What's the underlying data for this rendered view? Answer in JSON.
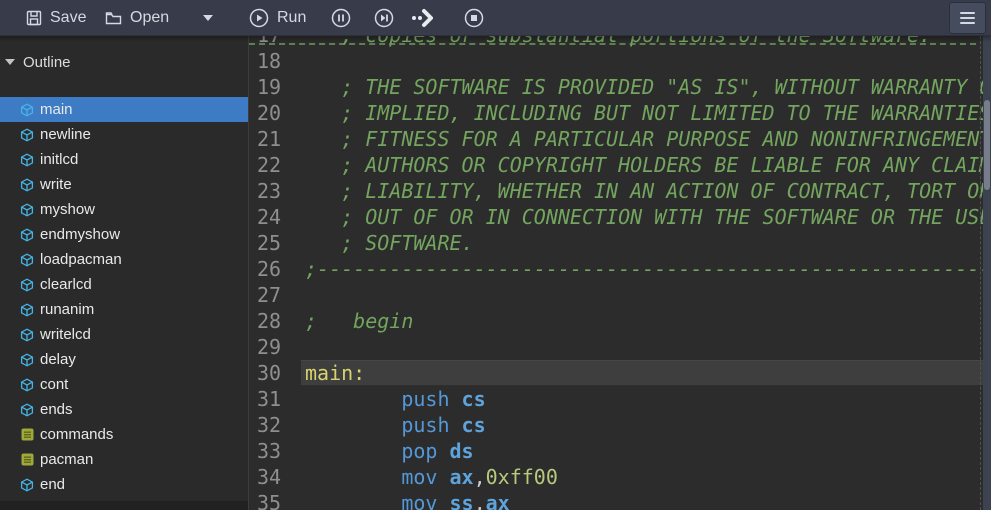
{
  "toolbar": {
    "save_label": "Save",
    "open_label": "Open",
    "run_label": "Run",
    "icons": [
      "floppy-icon",
      "folder-open-icon",
      "dropdown-caret-icon",
      "run-circle-icon",
      "pause-circle-icon",
      "step-forward-circle-icon",
      "fast-forward-icon",
      "stop-circle-icon",
      "hamburger-menu-icon"
    ],
    "colors": {
      "background": "#383c4a",
      "text": "#d3dae3"
    }
  },
  "sidebar": {
    "header": "Outline",
    "items": [
      {
        "label": "main",
        "icon": "cube-symbol-icon",
        "selected": true
      },
      {
        "label": "newline",
        "icon": "cube-symbol-icon",
        "selected": false
      },
      {
        "label": "initlcd",
        "icon": "cube-symbol-icon",
        "selected": false
      },
      {
        "label": "write",
        "icon": "cube-symbol-icon",
        "selected": false
      },
      {
        "label": "myshow",
        "icon": "cube-symbol-icon",
        "selected": false
      },
      {
        "label": "endmyshow",
        "icon": "cube-symbol-icon",
        "selected": false
      },
      {
        "label": "loadpacman",
        "icon": "cube-symbol-icon",
        "selected": false
      },
      {
        "label": "clearlcd",
        "icon": "cube-symbol-icon",
        "selected": false
      },
      {
        "label": "runanim",
        "icon": "cube-symbol-icon",
        "selected": false
      },
      {
        "label": "writelcd",
        "icon": "cube-symbol-icon",
        "selected": false
      },
      {
        "label": "delay",
        "icon": "cube-symbol-icon",
        "selected": false
      },
      {
        "label": "cont",
        "icon": "cube-symbol-icon",
        "selected": false
      },
      {
        "label": "ends",
        "icon": "cube-symbol-icon",
        "selected": false
      },
      {
        "label": "commands",
        "icon": "data-list-icon",
        "selected": false
      },
      {
        "label": "pacman",
        "icon": "data-list-icon",
        "selected": false
      },
      {
        "label": "end",
        "icon": "cube-symbol-icon",
        "selected": false
      }
    ],
    "colors": {
      "selection": "#3d7cc4",
      "cube": "#45b4e6",
      "data": "#9fa838"
    }
  },
  "editor": {
    "colors": {
      "background": "#2c2c2c",
      "comment": "#73a55f",
      "keyword": "#5498d7",
      "register": "#5fa3dc",
      "number": "#b6ca7e",
      "label": "#d9d26e",
      "line_number": "#8f8f8f",
      "current_line": "#3e3e3e"
    },
    "lines": [
      {
        "num": "17",
        "hl": false,
        "tokens": [
          {
            "t": "c",
            "x": "   ; copies or substantial portions of the Software."
          }
        ]
      },
      {
        "num": "18",
        "hl": false,
        "tokens": []
      },
      {
        "num": "19",
        "hl": false,
        "tokens": [
          {
            "t": "c",
            "x": "   ; THE SOFTWARE IS PROVIDED \"AS IS\", WITHOUT WARRANTY OF ANY KIND, EXPRESS OR"
          }
        ]
      },
      {
        "num": "20",
        "hl": false,
        "tokens": [
          {
            "t": "c",
            "x": "   ; IMPLIED, INCLUDING BUT NOT LIMITED TO THE WARRANTIES OF MERCHANTABILITY,"
          }
        ]
      },
      {
        "num": "21",
        "hl": false,
        "tokens": [
          {
            "t": "c",
            "x": "   ; FITNESS FOR A PARTICULAR PURPOSE AND NONINFRINGEMENT. IN NO EVENT SHALL THE"
          }
        ]
      },
      {
        "num": "22",
        "hl": false,
        "tokens": [
          {
            "t": "c",
            "x": "   ; AUTHORS OR COPYRIGHT HOLDERS BE LIABLE FOR ANY CLAIM, DAMAGES OR OTHER"
          }
        ]
      },
      {
        "num": "23",
        "hl": false,
        "tokens": [
          {
            "t": "c",
            "x": "   ; LIABILITY, WHETHER IN AN ACTION OF CONTRACT, TORT OR OTHERWISE, ARISING FROM,"
          }
        ]
      },
      {
        "num": "24",
        "hl": false,
        "tokens": [
          {
            "t": "c",
            "x": "   ; OUT OF OR IN CONNECTION WITH THE SOFTWARE OR THE USE OR OTHER DEALINGS IN THE"
          }
        ]
      },
      {
        "num": "25",
        "hl": false,
        "tokens": [
          {
            "t": "c",
            "x": "   ; SOFTWARE."
          }
        ]
      },
      {
        "num": "26",
        "hl": false,
        "tokens": [
          {
            "t": "c",
            "x": ";------------------------------------------------------------------------"
          }
        ]
      },
      {
        "num": "27",
        "hl": false,
        "tokens": []
      },
      {
        "num": "28",
        "hl": false,
        "tokens": [
          {
            "t": "c",
            "x": ";   begin"
          }
        ]
      },
      {
        "num": "29",
        "hl": false,
        "tokens": []
      },
      {
        "num": "30",
        "hl": true,
        "tokens": [
          {
            "t": "l",
            "x": "main:"
          }
        ]
      },
      {
        "num": "31",
        "hl": false,
        "tokens": [
          {
            "t": "w",
            "x": "        "
          },
          {
            "t": "k",
            "x": "push"
          },
          {
            "t": "w",
            "x": " "
          },
          {
            "t": "r",
            "x": "cs"
          }
        ]
      },
      {
        "num": "32",
        "hl": false,
        "tokens": [
          {
            "t": "w",
            "x": "        "
          },
          {
            "t": "k",
            "x": "push"
          },
          {
            "t": "w",
            "x": " "
          },
          {
            "t": "r",
            "x": "cs"
          }
        ]
      },
      {
        "num": "33",
        "hl": false,
        "tokens": [
          {
            "t": "w",
            "x": "        "
          },
          {
            "t": "k",
            "x": "pop"
          },
          {
            "t": "w",
            "x": " "
          },
          {
            "t": "r",
            "x": "ds"
          }
        ]
      },
      {
        "num": "34",
        "hl": false,
        "tokens": [
          {
            "t": "w",
            "x": "        "
          },
          {
            "t": "k",
            "x": "mov"
          },
          {
            "t": "w",
            "x": " "
          },
          {
            "t": "r",
            "x": "ax"
          },
          {
            "t": "p",
            "x": ","
          },
          {
            "t": "n",
            "x": "0xff00"
          }
        ]
      },
      {
        "num": "35",
        "hl": false,
        "tokens": [
          {
            "t": "w",
            "x": "        "
          },
          {
            "t": "k",
            "x": "mov"
          },
          {
            "t": "w",
            "x": " "
          },
          {
            "t": "r",
            "x": "ss"
          },
          {
            "t": "p",
            "x": ","
          },
          {
            "t": "r",
            "x": "ax"
          }
        ]
      }
    ]
  }
}
